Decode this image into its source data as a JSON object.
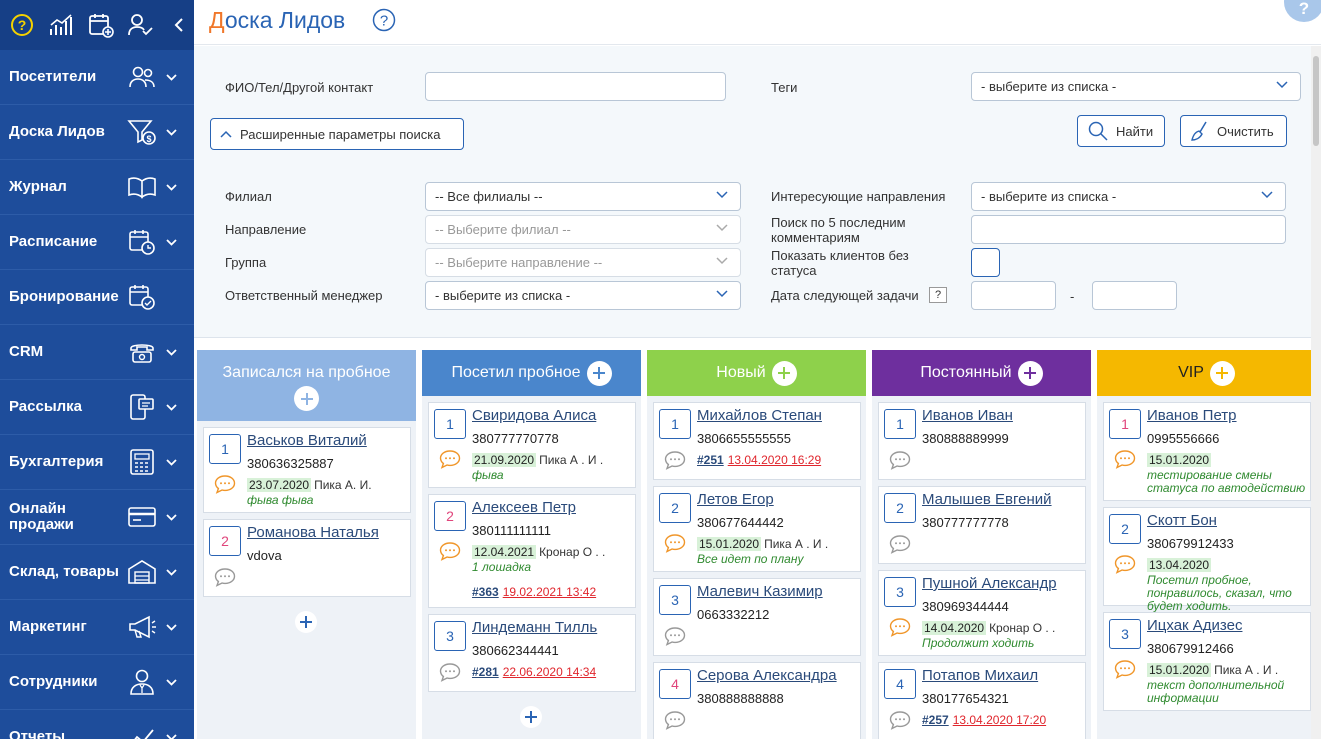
{
  "sidebar": {
    "top_icons": [
      "help-icon",
      "stats-icon",
      "calendar-add-icon",
      "user-check-icon",
      "collapse-chevron-icon"
    ],
    "items": [
      {
        "label": "Посетители",
        "icon": "users-icon",
        "has_chevron": true
      },
      {
        "label": "Доска Лидов",
        "icon": "funnel-money-icon",
        "has_chevron": true
      },
      {
        "label": "Журнал",
        "icon": "book-icon",
        "has_chevron": true
      },
      {
        "label": "Расписание",
        "icon": "calendar-clock-icon",
        "has_chevron": true
      },
      {
        "label": "Бронирование",
        "icon": "calendar-check-icon",
        "has_chevron": false
      },
      {
        "label": "CRM",
        "icon": "phone-icon",
        "has_chevron": true
      },
      {
        "label": "Рассылка",
        "icon": "mobile-message-icon",
        "has_chevron": true
      },
      {
        "label": "Бухгалтерия",
        "icon": "calculator-icon",
        "has_chevron": true
      },
      {
        "label": "Онлайн продажи",
        "icon": "credit-card-icon",
        "has_chevron": true
      },
      {
        "label": "Склад, товары",
        "icon": "warehouse-icon",
        "has_chevron": true
      },
      {
        "label": "Маркетинг",
        "icon": "megaphone-icon",
        "has_chevron": true
      },
      {
        "label": "Сотрудники",
        "icon": "employee-icon",
        "has_chevron": true
      },
      {
        "label": "Отчеты",
        "icon": "report-icon",
        "has_chevron": true
      }
    ]
  },
  "header": {
    "title_first": "Д",
    "title_rest": "оска Лидов"
  },
  "filters": {
    "contact_label": "ФИО/Тел/Другой контакт",
    "contact_value": "",
    "tags_label": "Теги",
    "tags_value": "- выберите из списка -",
    "advanced_label": "Расширенные параметры поиска",
    "find_label": "Найти",
    "clear_label": "Очистить",
    "branch_label": "Филиал",
    "branch_value": "-- Все филиалы --",
    "direction_label": "Направление",
    "direction_value": "-- Выберите филиал --",
    "group_label": "Группа",
    "group_value": "-- Выберите направление --",
    "manager_label": "Ответственный менеджер",
    "manager_value": "- выберите из списка -",
    "interest_label": "Интересующие направления",
    "interest_value": "- выберите из списка -",
    "comments_label": "Поиск по 5 последним комментариям",
    "nostatus_label": "Показать клиентов без статуса",
    "nexttask_label": "Дата следующей задачи",
    "nexttask_help": "?",
    "range_sep": "-"
  },
  "board": {
    "columns": [
      {
        "title": "Записался на пробное",
        "color": "#8fb4e3",
        "cards": [
          {
            "num": "1",
            "name": "Васьков Виталий",
            "phone": "380636325887",
            "date": "23.07.2020",
            "manager": "Пика А. И.",
            "comment": "фыва фыва",
            "task_num": "",
            "task_date": ""
          },
          {
            "num": "2",
            "name": "Романова Наталья",
            "phone": "vdova",
            "date": "",
            "manager": "",
            "comment": "",
            "task_num": "",
            "task_date": ""
          }
        ]
      },
      {
        "title": "Посетил пробное",
        "color": "#4a86cc",
        "cards": [
          {
            "num": "1",
            "name": "Свиридова Алиса",
            "phone": "380777770778",
            "date": "21.09.2020",
            "manager": "Пика А . И .",
            "comment": "фыва",
            "task_num": "",
            "task_date": ""
          },
          {
            "num": "2",
            "name": "Алексеев Петр",
            "phone": "380111111111",
            "date": "12.04.2021",
            "manager": "Кронар О . .",
            "comment": "1 лошадка",
            "task_num": "#363",
            "task_date": "19.02.2021 13:42"
          },
          {
            "num": "3",
            "name": "Линдеманн Тилль",
            "phone": "380662344441",
            "date": "",
            "manager": "",
            "comment": "",
            "task_num": "#281",
            "task_date": "22.06.2020 14:34"
          }
        ]
      },
      {
        "title": "Новый",
        "color": "#8ed14b",
        "cards": [
          {
            "num": "1",
            "name": "Михайлов Степан",
            "phone": "3806655555555",
            "date": "",
            "manager": "",
            "comment": "",
            "task_num": "#251",
            "task_date": "13.04.2020 16:29"
          },
          {
            "num": "2",
            "name": "Летов Егор",
            "phone": "380677644442",
            "date": "15.01.2020",
            "manager": "Пика А . И .",
            "comment": "Все идет по плану",
            "task_num": "",
            "task_date": ""
          },
          {
            "num": "3",
            "name": "Малевич Казимир",
            "phone": "0663332212",
            "date": "",
            "manager": "",
            "comment": "",
            "task_num": "",
            "task_date": ""
          },
          {
            "num": "4",
            "name": "Серова Александра",
            "phone": "380888888888",
            "date": "",
            "manager": "",
            "comment": "",
            "task_num": "",
            "task_date": ""
          }
        ]
      },
      {
        "title": "Постоянный",
        "color": "#6e2f9e",
        "cards": [
          {
            "num": "1",
            "name": "Иванов Иван",
            "phone": "380888889999",
            "date": "",
            "manager": "",
            "comment": "",
            "task_num": "",
            "task_date": ""
          },
          {
            "num": "2",
            "name": "Малышев Евгений",
            "phone": "380777777778",
            "date": "",
            "manager": "",
            "comment": "",
            "task_num": "",
            "task_date": ""
          },
          {
            "num": "3",
            "name": "Пушной Александр",
            "phone": "380969344444",
            "date": "14.04.2020",
            "manager": "Кронар О . .",
            "comment": "Продолжит ходить",
            "task_num": "",
            "task_date": ""
          },
          {
            "num": "4",
            "name": "Потапов Михаил",
            "phone": "380177654321",
            "date": "",
            "manager": "",
            "comment": "",
            "task_num": "#257",
            "task_date": "13.04.2020 17:20"
          }
        ]
      },
      {
        "title": "VIP",
        "color": "#f5b800",
        "cards": [
          {
            "num": "1",
            "name": "Иванов Петр",
            "phone": "0995556666",
            "date": "15.01.2020",
            "manager": "",
            "comment": "тестирование смены статуса по автодействию",
            "task_num": "",
            "task_date": ""
          },
          {
            "num": "2",
            "name": "Скотт Бон",
            "phone": "380679912433",
            "date": "13.04.2020",
            "manager": "",
            "comment": "Посетил пробное, понравилось, сказал, что будет ходить.",
            "task_num": "",
            "task_date": ""
          },
          {
            "num": "3",
            "name": "Ицхак Адизес",
            "phone": "380679912466",
            "date": "15.01.2020",
            "manager": "Пика А . И .",
            "comment": "текст дополнительной информации",
            "task_num": "",
            "task_date": ""
          }
        ]
      }
    ]
  }
}
